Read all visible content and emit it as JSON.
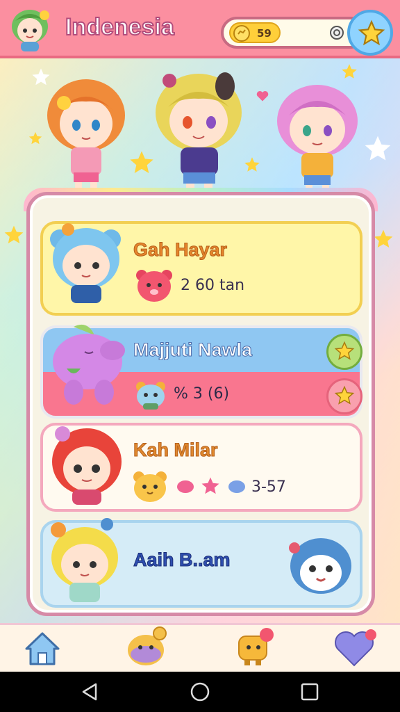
{
  "app": {
    "title": "Indenesia"
  },
  "header": {
    "coins": "59",
    "avatar_icon": "mascot-avatar-icon",
    "star_button_icon": "star-icon"
  },
  "cards": [
    {
      "name": "Gah Hayar",
      "stat": "2 60 tan",
      "color": "#fff6a8",
      "border": "#f2cf52",
      "name_color": "#e6862c"
    },
    {
      "name": "Majjuti Nawla",
      "stat": "% 3 (6)",
      "color_top": "#8fc7f2",
      "color_bottom": "#f9768f",
      "name_color": "#ffffff"
    },
    {
      "name": "Kah Milar",
      "stat": "3-57",
      "color": "#fffaf0",
      "border": "#f4a8bd",
      "name_color": "#e0892f"
    },
    {
      "name": "Aaih B..am",
      "stat": "",
      "color": "#d5ecf7",
      "border": "#a9d4ee",
      "name_color": "#2f4fb0"
    }
  ],
  "nav": {
    "items": [
      {
        "name": "home",
        "icon": "home-icon"
      },
      {
        "name": "pets",
        "icon": "pet-icon"
      },
      {
        "name": "friends",
        "icon": "friend-icon"
      },
      {
        "name": "favorites",
        "icon": "heart-icon"
      }
    ]
  },
  "system": {
    "back": "back-icon",
    "home": "home-circle-icon",
    "recent": "recent-square-icon"
  }
}
